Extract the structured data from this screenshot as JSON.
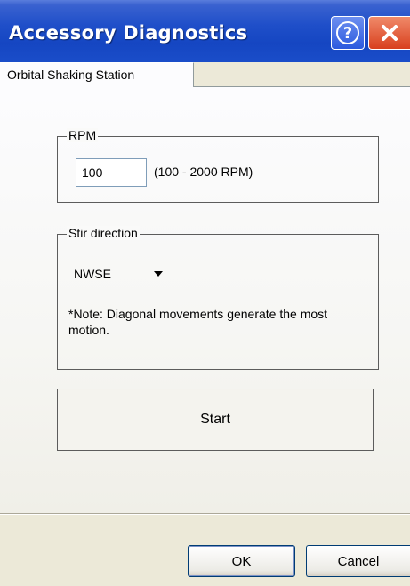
{
  "window": {
    "title": "Accessory Diagnostics",
    "help_glyph": "?",
    "close_glyph": "✕"
  },
  "tabs": [
    {
      "label": "Orbital Shaking Station",
      "selected": true
    }
  ],
  "rpm_group": {
    "legend": "RPM",
    "value": "100",
    "range_text": "(100 - 2000 RPM)"
  },
  "stir_group": {
    "legend": "Stir direction",
    "selected": "NWSE",
    "note": "*Note: Diagonal movements generate the most motion."
  },
  "actions": {
    "start_label": "Start",
    "ok_label": "OK",
    "cancel_label": "Cancel"
  },
  "icons": {
    "help": "help-icon",
    "close": "close-icon",
    "dropdown": "chevron-down-icon"
  },
  "colors": {
    "titlebar": "#1f4fc9",
    "close_button": "#d8401e",
    "dialog_face": "#ece9d8"
  }
}
